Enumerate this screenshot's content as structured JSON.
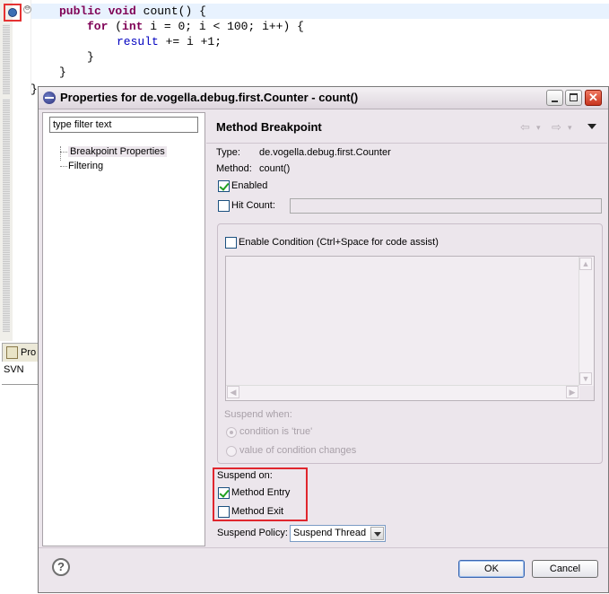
{
  "editor": {
    "lines": {
      "l1_kw1": "public",
      "l1_kw2": "void",
      "l1_rest": "count() {",
      "l2_kw1": "for",
      "l2_open": "(",
      "l2_kw2": "int",
      "l2_rest": "i = 0; i < 100; i++) {",
      "l3_field": "result",
      "l3_rest": "+= i +1;",
      "l4": "}",
      "l5": "}",
      "l6": "}"
    },
    "fold_glyph": "⊖"
  },
  "bottom_panel": {
    "tab_label": "Pro",
    "svn_label": "SVN"
  },
  "dialog": {
    "title": "Properties for de.vogella.debug.first.Counter - count()",
    "close_glyph": "✕",
    "filter": {
      "value": "type filter text",
      "placeholder": "type filter text"
    },
    "tree": {
      "items": [
        {
          "label": "Breakpoint Properties",
          "selected": true
        },
        {
          "label": "Filtering",
          "selected": false
        }
      ]
    },
    "page": {
      "title": "Method Breakpoint",
      "nav_back": "⇦",
      "nav_back_drop": "▾",
      "nav_fwd": "⇨",
      "nav_fwd_drop": "▾",
      "type_label": "Type:",
      "type_value": "de.vogella.debug.first.Counter",
      "method_label": "Method:",
      "method_value": "count()",
      "enabled_label": "Enabled",
      "enabled_checked": true,
      "hit_count_label": "Hit Count:",
      "hit_count_checked": false,
      "hit_count_value": "",
      "enable_condition_label": "Enable Condition (Ctrl+Space for code assist)",
      "enable_condition_checked": false,
      "condition_text": "",
      "scroll_up": "▲",
      "scroll_down": "▼",
      "scroll_left": "◀",
      "scroll_right": "▶",
      "suspend_when_label": "Suspend when:",
      "suspend_when_options": [
        {
          "label": "condition is 'true'",
          "selected": true
        },
        {
          "label": "value of condition changes",
          "selected": false
        }
      ],
      "suspend_on_label": "Suspend on:",
      "method_entry_label": "Method Entry",
      "method_entry_checked": true,
      "method_exit_label": "Method Exit",
      "method_exit_checked": false,
      "suspend_policy_label": "Suspend Policy:",
      "suspend_policy_value": "Suspend Thread"
    },
    "footer": {
      "help_glyph": "?",
      "ok_label": "OK",
      "cancel_label": "Cancel"
    }
  },
  "colors": {
    "highlight_box": "#e0262e",
    "keyword": "#7f0055",
    "field": "#0000c0",
    "dialog_bg": "#ece6ec"
  }
}
